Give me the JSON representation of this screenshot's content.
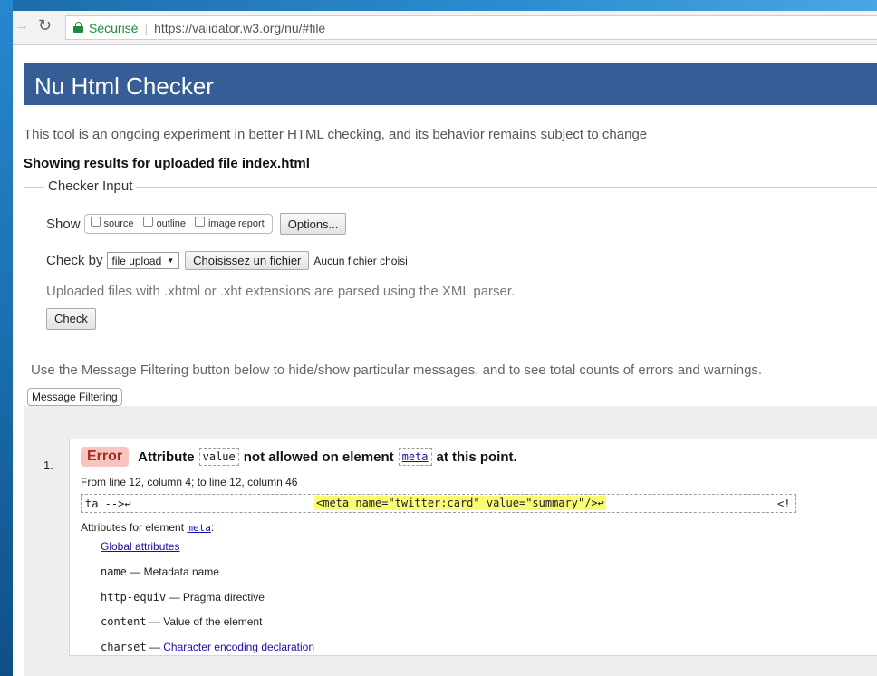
{
  "browser": {
    "secure_label": "Sécurisé",
    "url": "https://validator.w3.org/nu/#file"
  },
  "page": {
    "title": "Nu Html Checker",
    "intro": "This tool is an ongoing experiment in better HTML checking, and its behavior remains subject to change",
    "results_heading": "Showing results for uploaded file index.html"
  },
  "checker_input": {
    "legend": "Checker Input",
    "show_label": "Show",
    "show_options": [
      "source",
      "outline",
      "image report"
    ],
    "options_button": "Options...",
    "check_by_label": "Check by",
    "check_by_value": "file upload",
    "choose_file_button": "Choisissez un fichier",
    "no_file_text": "Aucun fichier choisi",
    "xml_note": "Uploaded files with .xhtml or .xht extensions are parsed using the XML parser.",
    "check_button": "Check"
  },
  "filter": {
    "note": "Use the Message Filtering button below to hide/show particular messages, and to see total counts of errors and warnings.",
    "button": "Message Filtering"
  },
  "message": {
    "number": "1.",
    "type": "Error",
    "text_before": "Attribute",
    "attr_code": "value",
    "text_middle": "not allowed on element",
    "element_code": "meta",
    "text_after": "at this point.",
    "location": "From line 12, column 4; to line 12, column 46",
    "extract_before": "ta -->↩",
    "extract_highlight": "<meta name=\"twitter:card\" value=\"summary\"/>↩",
    "extract_after": "<!",
    "attributes_label": "Attributes for element",
    "attributes_element": "meta",
    "attributes_colon": ":",
    "attributes": [
      {
        "name": "",
        "sep": "",
        "desc": "Global attributes",
        "is_link": true
      },
      {
        "name": "name",
        "sep": " — ",
        "desc": "Metadata name",
        "is_link": false
      },
      {
        "name": "http-equiv",
        "sep": " — ",
        "desc": "Pragma directive",
        "is_link": false
      },
      {
        "name": "content",
        "sep": " — ",
        "desc": "Value of the element",
        "is_link": false
      },
      {
        "name": "charset",
        "sep": " — ",
        "desc": "Character encoding declaration",
        "is_link": true
      }
    ]
  }
}
